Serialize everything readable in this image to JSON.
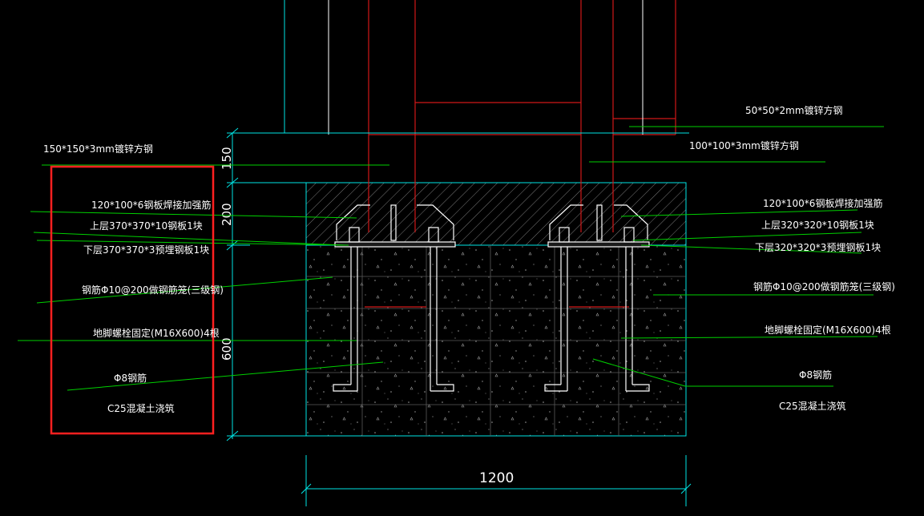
{
  "drawing": {
    "dimensions": {
      "top_150": "150",
      "mid_200": "200",
      "low_600": "600",
      "width_1200": "1200"
    },
    "left_labels": {
      "tube_150": "150*150*3mm镀锌方钢",
      "stiffener": "120*100*6钢板焊接加强筋",
      "upper_plate": "上层370*370*10钢板1块",
      "lower_plate": "下层370*370*3预埋钢板1块",
      "rebar_cage": "钢筋Φ10@200做钢筋笼(三级钢)",
      "anchor_bolt": "地脚螺栓固定(M16X600)4根",
      "rebar_8": "Φ8钢筋",
      "concrete": "C25混凝土浇筑"
    },
    "right_labels": {
      "tube_50": "50*50*2mm镀锌方钢",
      "tube_100": "100*100*3mm镀锌方钢",
      "stiffener": "120*100*6钢板焊接加强筋",
      "upper_plate": "上层320*320*10钢板1块",
      "lower_plate": "下层320*320*3预埋钢板1块",
      "rebar_cage": "钢筋Φ10@200做钢筋笼(三级钢)",
      "anchor_bolt": "地脚螺栓固定(M16X600)4根",
      "rebar_8": "Φ8钢筋",
      "concrete": "C25混凝土浇筑"
    }
  },
  "colors": {
    "background": "#000000",
    "dimension": "#00e5e5",
    "leader": "#00d000",
    "structure": "#d01818",
    "bolt": "#ffffff",
    "highlight_box": "#ff2020",
    "text": "#ffffff"
  }
}
